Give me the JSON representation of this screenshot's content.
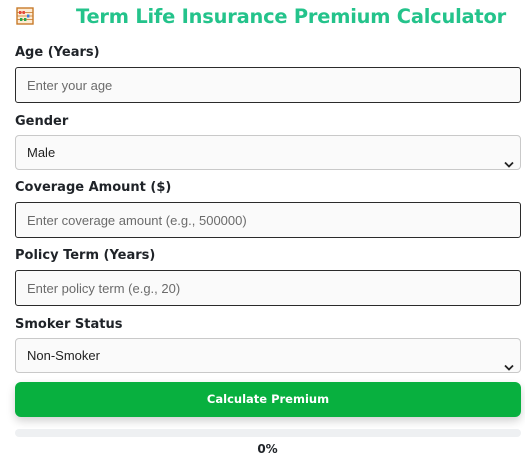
{
  "header": {
    "title": "Term Life Insurance Premium Calculator",
    "icon": "abacus-icon"
  },
  "form": {
    "age": {
      "label": "Age (Years)",
      "placeholder": "Enter your age",
      "value": ""
    },
    "gender": {
      "label": "Gender",
      "selected": "Male"
    },
    "coverage": {
      "label": "Coverage Amount ($)",
      "placeholder": "Enter coverage amount (e.g., 500000)",
      "value": ""
    },
    "policy_term": {
      "label": "Policy Term (Years)",
      "placeholder": "Enter policy term (e.g., 20)",
      "value": ""
    },
    "smoker": {
      "label": "Smoker Status",
      "selected": "Non-Smoker"
    }
  },
  "actions": {
    "calculate_label": "Calculate Premium"
  },
  "progress": {
    "value_percent": 0,
    "text": "0%"
  },
  "colors": {
    "title": "#24c38b",
    "button": "#08b03f",
    "progress_track": "#eef0f2"
  }
}
